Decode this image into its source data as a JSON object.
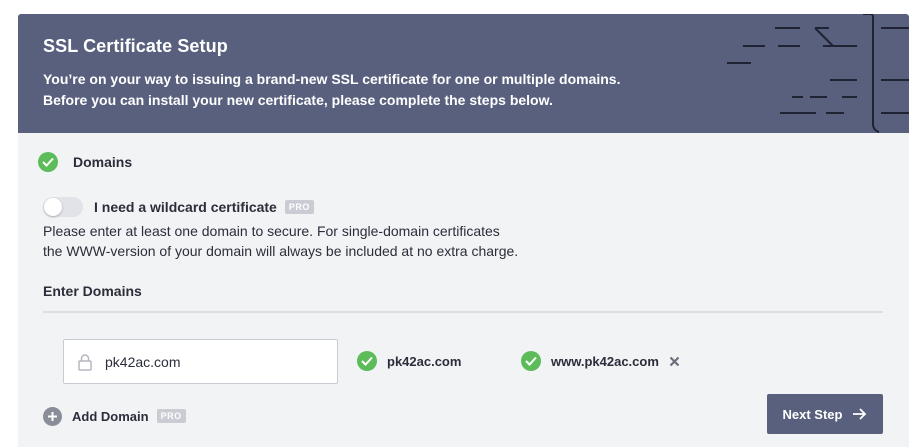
{
  "header": {
    "title": "SSL Certificate Setup",
    "description_line1": "You’re on your way to issuing a brand-new SSL certificate for one or multiple domains.",
    "description_line2": "Before you can install your new certificate, please complete the steps below."
  },
  "step": {
    "label": "Domains",
    "status_icon": "check-icon"
  },
  "wildcard": {
    "label": "I need a wildcard certificate",
    "badge": "PRO",
    "enabled": false
  },
  "instructions": {
    "line1": "Please enter at least one domain to secure. For single-domain certificates",
    "line2": "the WWW-version of your domain will always be included at no extra charge."
  },
  "domains_section": {
    "label": "Enter Domains",
    "input_value": "pk42ac.com",
    "entries": [
      {
        "name": "pk42ac.com",
        "removable": false
      },
      {
        "name": "www.pk42ac.com",
        "removable": true
      }
    ]
  },
  "add_domain": {
    "label": "Add Domain",
    "badge": "PRO"
  },
  "next_button": {
    "label": "Next Step"
  },
  "colors": {
    "header_bg": "#58607e",
    "success_green": "#5cbc5a",
    "page_bg": "#f2f3f5",
    "badge_gray": "#c9ccd3"
  }
}
